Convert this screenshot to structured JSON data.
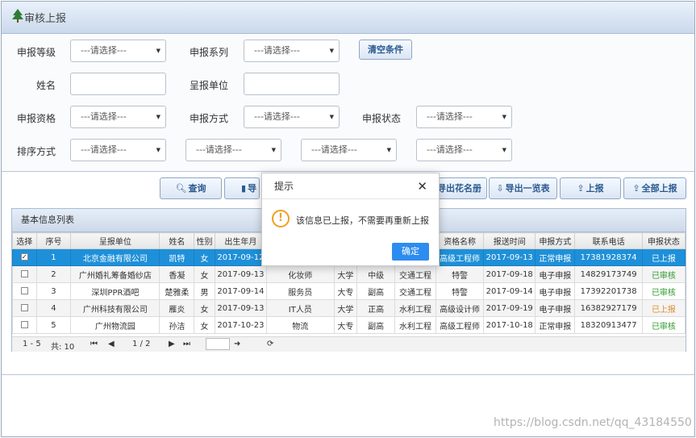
{
  "title": "审核上报",
  "filters": {
    "labels": {
      "level": "申报等级",
      "series": "申报系列",
      "name": "姓名",
      "unit": "呈报单位",
      "qualification": "申报资格",
      "method": "申报方式",
      "status": "申报状态",
      "sort": "排序方式"
    },
    "placeholder": "---请选择---",
    "clear_label": "清空条件"
  },
  "toolbar": {
    "query": "查询",
    "export": "导",
    "export_roster": "导出花名册",
    "export_list": "导出一览表",
    "report": "上报",
    "report_all": "全部上报"
  },
  "panel_title": "基本信息列表",
  "table": {
    "headers": [
      "选择",
      "序号",
      "呈报单位",
      "姓名",
      "性别",
      "出生年月",
      "",
      "",
      "",
      "",
      "资格名称",
      "报送时间",
      "申报方式",
      "联系电话",
      "申报状态"
    ],
    "rows": [
      {
        "check": "✓",
        "no": "1",
        "unit": "北京金融有限公司",
        "name": "凯特",
        "sex": "女",
        "birth": "2017-09-12",
        "c7": "",
        "c8": "",
        "c9": "",
        "c10": "",
        "qual": "高级工程师",
        "time": "2017-09-13",
        "method": "正常申报",
        "phone": "17381928374",
        "status": "已上报"
      },
      {
        "check": "",
        "no": "2",
        "unit": "广州婚礼筹备婚纱店",
        "name": "香凝",
        "sex": "女",
        "birth": "2017-09-13",
        "c7": "化妆师",
        "c8": "大学",
        "c9": "中级",
        "c10": "交通工程",
        "qual": "特警",
        "time": "2017-09-18",
        "method": "电子申报",
        "phone": "14829173749",
        "status": "已审核"
      },
      {
        "check": "",
        "no": "3",
        "unit": "深圳PPR酒吧",
        "name": "楚雅柔",
        "sex": "男",
        "birth": "2017-09-14",
        "c7": "服务员",
        "c8": "大专",
        "c9": "副高",
        "c10": "交通工程",
        "qual": "特警",
        "time": "2017-09-14",
        "method": "电子申报",
        "phone": "17392201738",
        "status": "已审核"
      },
      {
        "check": "",
        "no": "4",
        "unit": "广州科技有限公司",
        "name": "雁炎",
        "sex": "女",
        "birth": "2017-09-13",
        "c7": "IT人员",
        "c8": "大学",
        "c9": "正高",
        "c10": "水利工程",
        "qual": "高级设计师",
        "time": "2017-09-19",
        "method": "电子申报",
        "phone": "16382927179",
        "status": "已上报"
      },
      {
        "check": "",
        "no": "5",
        "unit": "广州物流园",
        "name": "孙洁",
        "sex": "女",
        "birth": "2017-10-23",
        "c7": "物流",
        "c8": "大专",
        "c9": "副高",
        "c10": "水利工程",
        "qual": "高级工程师",
        "time": "2017-10-18",
        "method": "正常申报",
        "phone": "18320913477",
        "status": "已审核"
      }
    ]
  },
  "pager": {
    "range": "1 - 5",
    "total": "共: 10",
    "page": "1 / 2"
  },
  "dialog": {
    "title": "提示",
    "message": "该信息已上报，不需要再重新上报",
    "ok": "确定"
  },
  "watermark": "https://blog.csdn.net/qq_43184550",
  "colors": {
    "selected_row": "#1e90d9",
    "status_reviewed": "#2b9a2b",
    "status_reported": "#e08a2e",
    "ok_button": "#2d8cf0"
  }
}
